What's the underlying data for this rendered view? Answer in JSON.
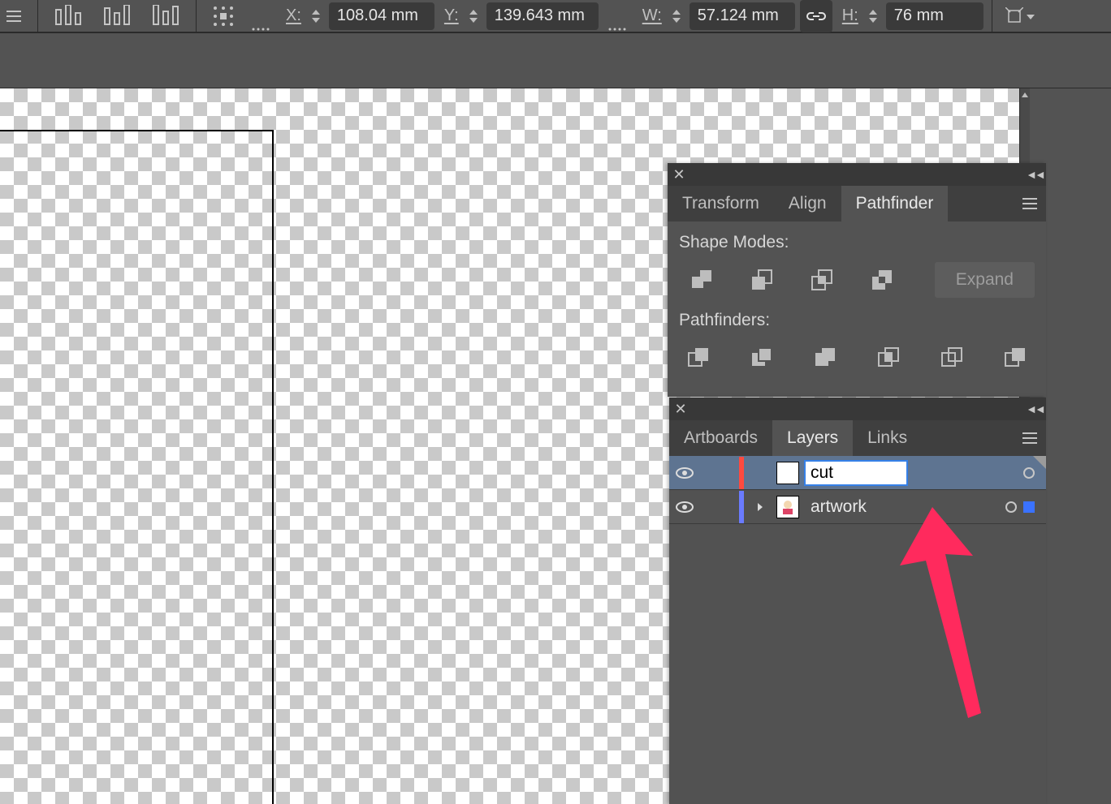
{
  "toolbar": {
    "x_label": "X:",
    "x_value": "108.04 mm",
    "y_label": "Y:",
    "y_value": "139.643 mm",
    "w_label": "W:",
    "w_value": "57.124 mm",
    "h_label": "H:",
    "h_value": "76 mm"
  },
  "pathfinder_panel": {
    "tabs": [
      "Transform",
      "Align",
      "Pathfinder"
    ],
    "active_tab": 2,
    "shape_modes_label": "Shape Modes:",
    "expand_label": "Expand",
    "pathfinders_label": "Pathfinders:"
  },
  "layers_panel": {
    "tabs": [
      "Artboards",
      "Layers",
      "Links"
    ],
    "active_tab": 1,
    "rows": [
      {
        "name": "cut",
        "editing": true,
        "color": "#ff4a3f",
        "selected_row": true
      },
      {
        "name": "artwork",
        "editing": false,
        "color": "#6a7bff",
        "selected_row": false
      }
    ]
  },
  "annotation": {
    "arrow_color": "#ff2a5d"
  }
}
